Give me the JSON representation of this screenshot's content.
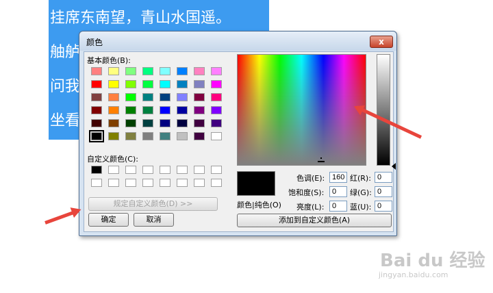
{
  "document": {
    "lines": [
      "挂席东南望，青山水国遥。",
      "舳舻",
      "问我",
      "坐看"
    ]
  },
  "dialog": {
    "title": "颜色",
    "close_label": "x",
    "basic_colors_label": "基本颜色(B):",
    "custom_colors_label": "自定义颜色(C):",
    "define_custom_button": "规定自定义颜色(D) >>",
    "ok_button": "确定",
    "cancel_button": "取消",
    "color_solid_label": "颜色|纯色(O)",
    "hue_label": "色调(E):",
    "sat_label": "饱和度(S):",
    "lum_label": "亮度(L):",
    "red_label": "红(R):",
    "green_label": "绿(G):",
    "blue_label": "蓝(U):",
    "hue_value": "160",
    "sat_value": "0",
    "lum_value": "0",
    "red_value": "0",
    "green_value": "0",
    "blue_value": "0",
    "add_custom_button": "添加到自定义颜色(A)",
    "preview_color": "#000000",
    "basic_colors": [
      [
        "#ff8080",
        "#ffff80",
        "#80ff80",
        "#00ff80",
        "#80ffff",
        "#0080ff",
        "#ff80c0",
        "#ff80ff"
      ],
      [
        "#ff0000",
        "#ffff00",
        "#80ff00",
        "#00ff40",
        "#00ffff",
        "#0080c0",
        "#8080c0",
        "#ff00ff"
      ],
      [
        "#804040",
        "#ff8040",
        "#00ff00",
        "#008080",
        "#004080",
        "#8080ff",
        "#800040",
        "#ff0080"
      ],
      [
        "#800000",
        "#ff8000",
        "#008000",
        "#008040",
        "#0000ff",
        "#0000a0",
        "#800080",
        "#8000ff"
      ],
      [
        "#400000",
        "#804000",
        "#004000",
        "#004040",
        "#000080",
        "#000040",
        "#400040",
        "#400080"
      ],
      [
        "#000000",
        "#808000",
        "#808040",
        "#808080",
        "#408080",
        "#c0c0c0",
        "#400040",
        "#ffffff"
      ]
    ],
    "selected_basic": [
      5,
      0
    ],
    "custom_colors": [
      [
        "#000000",
        "#ffffff",
        "#ffffff",
        "#ffffff",
        "#ffffff",
        "#ffffff",
        "#ffffff",
        "#ffffff"
      ],
      [
        "#ffffff",
        "#ffffff",
        "#ffffff",
        "#ffffff",
        "#ffffff",
        "#ffffff",
        "#ffffff",
        "#ffffff"
      ]
    ]
  },
  "watermark": {
    "brand": "Bai du 经验",
    "url": "jingyan.baidu.com"
  },
  "colors": {
    "selection": "#3d9bf0",
    "arrow": "#e8453c"
  }
}
